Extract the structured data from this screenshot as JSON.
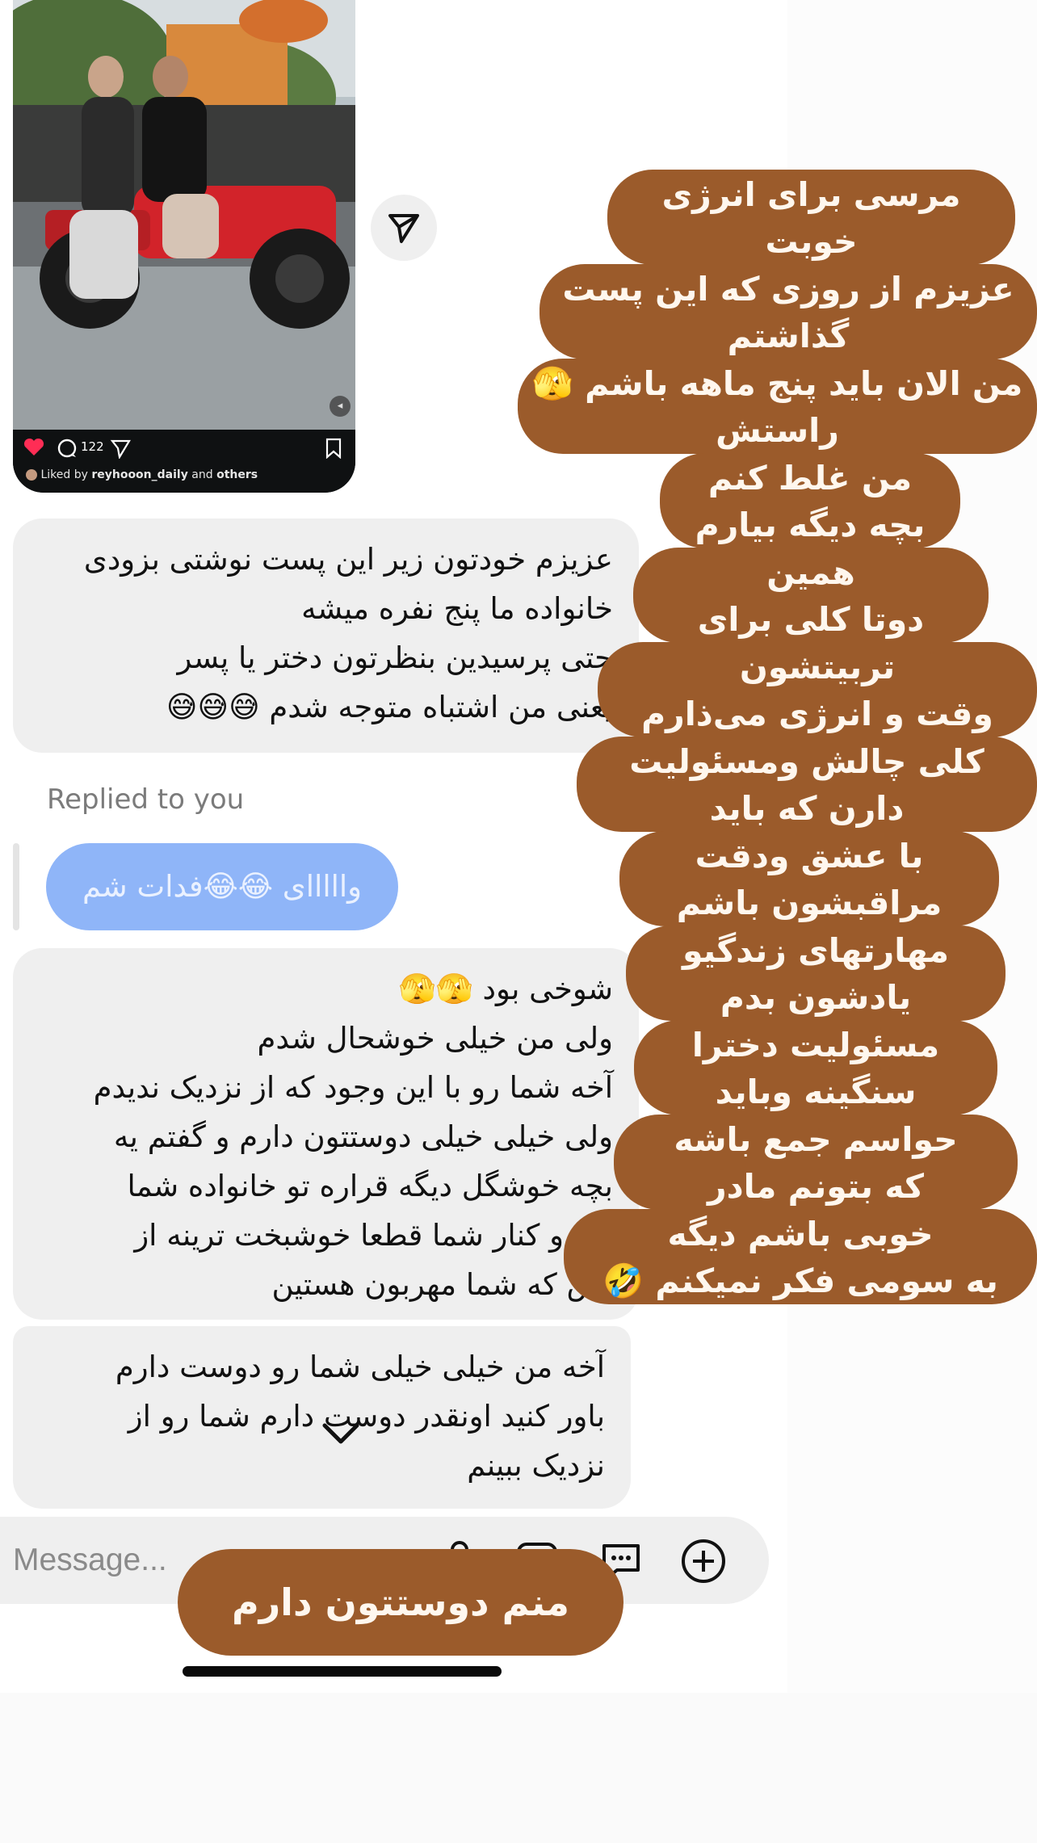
{
  "post": {
    "comment_count": "122",
    "liked_by_prefix": "Liked by",
    "liked_by_user": "reyhooon_daily",
    "liked_by_and": "and",
    "liked_by_others": "others"
  },
  "messages": {
    "bubble1": "عزیزم خودتون زیر این پست نوشتی بزودی\nخانواده ما پنج نفره میشه\nحتی پرسیدین بنظرتون دختر یا پسر\nیعنی من اشتباه متوجه شدم 😅😅😅",
    "replied_label": "Replied to you",
    "reply_text": "وااااای 😂😂فدات شم",
    "bubble3": "شوخی بود 🫣🫣\nولی من خیلی خوشحال  شدم\nآخه شما رو با این وجود که از نزدیک ندیدم\nولی خیلی خیلی دوستتون دارم و گفتم یه\nبچه خوشگل دیگه قراره تو خانواده شما\nبیاد و کنار شما قطعا خوشبخت ترینه از\nبس که شما مهربون هستین",
    "bubble4": "آخه من خیلی خیلی شما رو دوست دارم\nباور کنید اونقدر دوست دارم شما رو از\nنزدیک ببینم"
  },
  "composer": {
    "placeholder": "Message..."
  },
  "overlay": {
    "lines": [
      "مرسی برای انرژی\nخوبت",
      "عزیزم از روزی که این پست\nگذاشتم",
      "من الان باید پنج ماهه باشم 🫣\nراستش",
      "من غلط کنم\nبچه دیگه بیارم",
      "همین\nدوتا  کلی برای",
      "تربیتشون\nوقت و انرژی می‌ذارم",
      "کلی چالش ومسئولیت\nدارن که باید",
      "با عشق ودقت\nمراقبشون باشم",
      "مهارتهای زندگیو\nیادشون بدم",
      "مسئولیت دخترا\nسنگینه وباید",
      "حواسم جمع باشه\nکه بتونم مادر",
      "خوبی باشم دیگه\nبه سومی فکر نمیکنم 🤣"
    ],
    "bottom": "منم دوستتون دارم"
  },
  "colors": {
    "highlight": "#9b5b2b",
    "reply_bubble": "#8fb5f8",
    "bubble": "#efefef"
  }
}
